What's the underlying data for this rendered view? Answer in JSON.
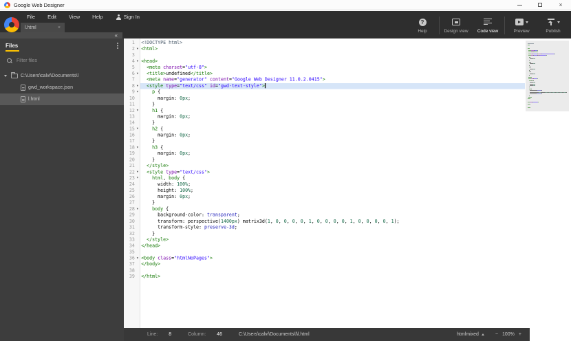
{
  "window": {
    "title": "Google Web Designer",
    "controls": [
      {
        "name": "minimize"
      },
      {
        "name": "maximize"
      },
      {
        "name": "close",
        "glyph": "×"
      }
    ]
  },
  "menubar": {
    "items": [
      "File",
      "Edit",
      "View",
      "Help"
    ],
    "sign_in": "Sign In"
  },
  "tab": {
    "label": "l.html",
    "close_glyph": "×"
  },
  "toolbar": {
    "buttons": [
      {
        "id": "help",
        "label": "Help",
        "icon": "help-icon",
        "glyph": "?",
        "dropdown": false,
        "active": false,
        "sep_after": true
      },
      {
        "id": "design-view",
        "label": "Design view",
        "icon": "design-view-icon",
        "dropdown": false,
        "active": false,
        "sep_after": false
      },
      {
        "id": "code-view",
        "label": "Code view",
        "icon": "code-view-icon",
        "dropdown": false,
        "active": true,
        "sep_after": true
      },
      {
        "id": "preview",
        "label": "Preview",
        "icon": "preview-icon",
        "dropdown": true,
        "active": false,
        "sep_after": false
      },
      {
        "id": "publish",
        "label": "Publish",
        "icon": "publish-icon",
        "dropdown": true,
        "active": false,
        "sep_after": false
      }
    ]
  },
  "files_panel": {
    "title": "Files",
    "collapse_glyph": "«",
    "filter_placeholder": "Filter files",
    "tree": [
      {
        "label": "C:\\Users\\calvi\\Documents\\l",
        "type": "folder",
        "icon": "folder-icon",
        "expanded": true,
        "selected": false
      },
      {
        "label": "gwd_workspace.json",
        "type": "file",
        "icon": "file-icon",
        "selected": false
      },
      {
        "label": "l.html",
        "type": "file",
        "icon": "file-icon",
        "selected": true
      }
    ]
  },
  "editor": {
    "active_line": 8,
    "fold_lines": [
      2,
      4,
      6,
      8,
      9,
      12,
      15,
      18,
      22,
      23,
      28,
      36
    ],
    "fold_glyph": "▾",
    "active_line_color": "#d6e5f8",
    "syntax_colors": {
      "m": "#445566",
      "t": "#117700",
      "a": "#7700AA",
      "s": "#2A00FF",
      "p": "#000000",
      "n": "#116644",
      "at": "#2222BB"
    },
    "lines": [
      [
        [
          "m",
          "<!DOCTYPE html>"
        ]
      ],
      [
        [
          "t",
          "<html>"
        ]
      ],
      [],
      [
        [
          "t",
          "<head>"
        ]
      ],
      [
        [
          "t",
          "  <meta "
        ],
        [
          "a",
          "charset"
        ],
        [
          "p",
          "="
        ],
        [
          "s",
          "\"utf-8\""
        ],
        [
          "t",
          ">"
        ]
      ],
      [
        [
          "t",
          "  <title>"
        ],
        [
          "p",
          "undefined"
        ],
        [
          "t",
          "</title>"
        ]
      ],
      [
        [
          "t",
          "  <meta "
        ],
        [
          "a",
          "name"
        ],
        [
          "p",
          "="
        ],
        [
          "s",
          "\"generator\""
        ],
        [
          "p",
          " "
        ],
        [
          "a",
          "content"
        ],
        [
          "p",
          "="
        ],
        [
          "s",
          "\"Google Web Designer 11.0.2.0415\""
        ],
        [
          "t",
          ">"
        ]
      ],
      [
        [
          "t",
          "  <style "
        ],
        [
          "a",
          "type"
        ],
        [
          "p",
          "="
        ],
        [
          "s",
          "\"text/css\""
        ],
        [
          "p",
          " "
        ],
        [
          "a",
          "id"
        ],
        [
          "p",
          "="
        ],
        [
          "s",
          "\"gwd-text-style\""
        ],
        [
          "t",
          ">"
        ]
      ],
      [
        [
          "t",
          "    p"
        ],
        [
          "p",
          " {"
        ]
      ],
      [
        [
          "p",
          "      margin: "
        ],
        [
          "n",
          "0px"
        ],
        [
          "p",
          ";"
        ]
      ],
      [
        [
          "p",
          "    }"
        ]
      ],
      [
        [
          "t",
          "    h1"
        ],
        [
          "p",
          " {"
        ]
      ],
      [
        [
          "p",
          "      margin: "
        ],
        [
          "n",
          "0px"
        ],
        [
          "p",
          ";"
        ]
      ],
      [
        [
          "p",
          "    }"
        ]
      ],
      [
        [
          "t",
          "    h2"
        ],
        [
          "p",
          " {"
        ]
      ],
      [
        [
          "p",
          "      margin: "
        ],
        [
          "n",
          "0px"
        ],
        [
          "p",
          ";"
        ]
      ],
      [
        [
          "p",
          "    }"
        ]
      ],
      [
        [
          "t",
          "    h3"
        ],
        [
          "p",
          " {"
        ]
      ],
      [
        [
          "p",
          "      margin: "
        ],
        [
          "n",
          "0px"
        ],
        [
          "p",
          ";"
        ]
      ],
      [
        [
          "p",
          "    }"
        ]
      ],
      [
        [
          "t",
          "  </style>"
        ]
      ],
      [
        [
          "t",
          "  <style "
        ],
        [
          "a",
          "type"
        ],
        [
          "p",
          "="
        ],
        [
          "s",
          "\"text/css\""
        ],
        [
          "t",
          ">"
        ]
      ],
      [
        [
          "t",
          "    html"
        ],
        [
          "p",
          ", "
        ],
        [
          "t",
          "body"
        ],
        [
          "p",
          " {"
        ]
      ],
      [
        [
          "p",
          "      width: "
        ],
        [
          "n",
          "100%"
        ],
        [
          "p",
          ";"
        ]
      ],
      [
        [
          "p",
          "      height: "
        ],
        [
          "n",
          "100%"
        ],
        [
          "p",
          ";"
        ]
      ],
      [
        [
          "p",
          "      margin: "
        ],
        [
          "n",
          "0px"
        ],
        [
          "p",
          ";"
        ]
      ],
      [
        [
          "p",
          "    }"
        ]
      ],
      [
        [
          "t",
          "    body"
        ],
        [
          "p",
          " {"
        ]
      ],
      [
        [
          "p",
          "      background-color: "
        ],
        [
          "at",
          "transparent"
        ],
        [
          "p",
          ";"
        ]
      ],
      [
        [
          "p",
          "      transform: perspective("
        ],
        [
          "n",
          "1400px"
        ],
        [
          "p",
          ") matrix3d("
        ],
        [
          "n",
          "1"
        ],
        [
          "p",
          ", "
        ],
        [
          "n",
          "0"
        ],
        [
          "p",
          ", "
        ],
        [
          "n",
          "0"
        ],
        [
          "p",
          ", "
        ],
        [
          "n",
          "0"
        ],
        [
          "p",
          ", "
        ],
        [
          "n",
          "0"
        ],
        [
          "p",
          ", "
        ],
        [
          "n",
          "1"
        ],
        [
          "p",
          ", "
        ],
        [
          "n",
          "0"
        ],
        [
          "p",
          ", "
        ],
        [
          "n",
          "0"
        ],
        [
          "p",
          ", "
        ],
        [
          "n",
          "0"
        ],
        [
          "p",
          ", "
        ],
        [
          "n",
          "0"
        ],
        [
          "p",
          ", "
        ],
        [
          "n",
          "1"
        ],
        [
          "p",
          ", "
        ],
        [
          "n",
          "0"
        ],
        [
          "p",
          ", "
        ],
        [
          "n",
          "0"
        ],
        [
          "p",
          ", "
        ],
        [
          "n",
          "0"
        ],
        [
          "p",
          ", "
        ],
        [
          "n",
          "0"
        ],
        [
          "p",
          ", "
        ],
        [
          "n",
          "1"
        ],
        [
          "p",
          ");"
        ]
      ],
      [
        [
          "p",
          "      transform-style: "
        ],
        [
          "at",
          "preserve-3d"
        ],
        [
          "p",
          ";"
        ]
      ],
      [
        [
          "p",
          "    }"
        ]
      ],
      [
        [
          "t",
          "  </style>"
        ]
      ],
      [
        [
          "t",
          "</head>"
        ]
      ],
      [],
      [
        [
          "t",
          "<body "
        ],
        [
          "a",
          "class"
        ],
        [
          "p",
          "="
        ],
        [
          "s",
          "\"htmlNoPages\""
        ],
        [
          "t",
          ">"
        ]
      ],
      [
        [
          "t",
          "</body>"
        ]
      ],
      [],
      [
        [
          "t",
          "</html>"
        ]
      ]
    ]
  },
  "statusbar": {
    "line_label": "Line:",
    "line_value": "8",
    "column_label": "Column:",
    "column_value": "46",
    "file_path": "C:\\Users\\calvi\\Documents\\l\\l.html",
    "mode": "htmlmixed",
    "zoom_out": "−",
    "zoom_level": "100%",
    "zoom_in": "+"
  },
  "colors": {
    "accent_yellow": "#FFC400",
    "header_bg": "#2e2e2e",
    "panel_bg": "#3d3d3d",
    "logo_blue": "#4285F4",
    "logo_red": "#EA4335",
    "logo_yellow": "#FBBC04"
  }
}
